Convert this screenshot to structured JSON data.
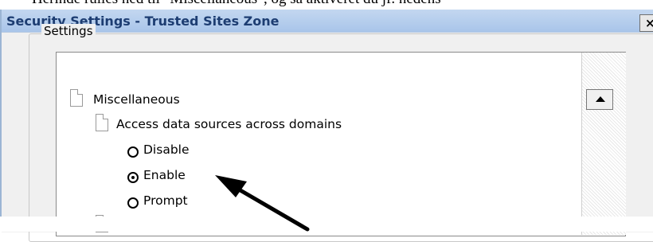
{
  "document": {
    "partial_line": "Herinde rulles ned til \"Miscellaneous\", og så aktiveret du jf. nedens"
  },
  "window": {
    "title": "Security Settings - Trusted Sites Zone",
    "close_glyph": "×"
  },
  "settings": {
    "group_label": "Settings",
    "tree": {
      "category": "Miscellaneous",
      "setting": "Access data sources across domains",
      "options": [
        {
          "label": "Disable",
          "selected": false
        },
        {
          "label": "Enable",
          "selected": true
        },
        {
          "label": "Prompt",
          "selected": false
        }
      ]
    }
  },
  "icons": {
    "category_icon": "document-icon",
    "setting_icon": "document-icon",
    "scroll_up": "arrow-up-icon",
    "annotation": "pointer-arrow"
  },
  "colors": {
    "title_text": "#1d3d72",
    "title_bar": "#b8cfec",
    "annotation_arrow": "#000000"
  }
}
